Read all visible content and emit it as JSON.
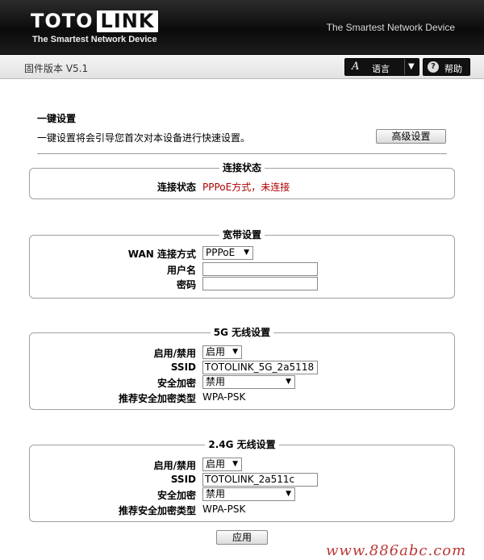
{
  "header": {
    "logo_word1": "TOTO",
    "logo_word2": "LINK",
    "logo_tagline": "The Smartest Network Device",
    "slogan": "The Smartest Network Device"
  },
  "toolbar": {
    "firmware": "固件版本 V5.1",
    "language_icon": "A",
    "language_label": "语言",
    "help_icon": "?",
    "help_label": "帮助"
  },
  "setup": {
    "title": "一键设置",
    "description": "一键设置将会引导您首次对本设备进行快速设置。",
    "advanced_button": "高级设置"
  },
  "connection": {
    "legend": "连接状态",
    "status_label": "连接状态",
    "status_value": "PPPoE方式，未连接"
  },
  "broadband": {
    "legend": "宽带设置",
    "wan_label": "WAN 连接方式",
    "wan_value": "PPPoE",
    "username_label": "用户名",
    "username_value": "",
    "password_label": "密码",
    "password_value": ""
  },
  "wifi5g": {
    "legend": "5G 无线设置",
    "enable_label": "启用/禁用",
    "enable_value": "启用",
    "ssid_label": "SSID",
    "ssid_value": "TOTOLINK_5G_2a5118",
    "security_label": "安全加密",
    "security_value": "禁用",
    "recommend_label": "推荐安全加密类型",
    "recommend_value": "WPA-PSK"
  },
  "wifi24g": {
    "legend": "2.4G 无线设置",
    "enable_label": "启用/禁用",
    "enable_value": "启用",
    "ssid_label": "SSID",
    "ssid_value": "TOTOLINK_2a511c",
    "security_label": "安全加密",
    "security_value": "禁用",
    "recommend_label": "推荐安全加密类型",
    "recommend_value": "WPA-PSK"
  },
  "apply_button": "应用",
  "watermark": "www.886abc.com",
  "colors": {
    "header_bg": "#111111",
    "status_red": "#b00000"
  }
}
